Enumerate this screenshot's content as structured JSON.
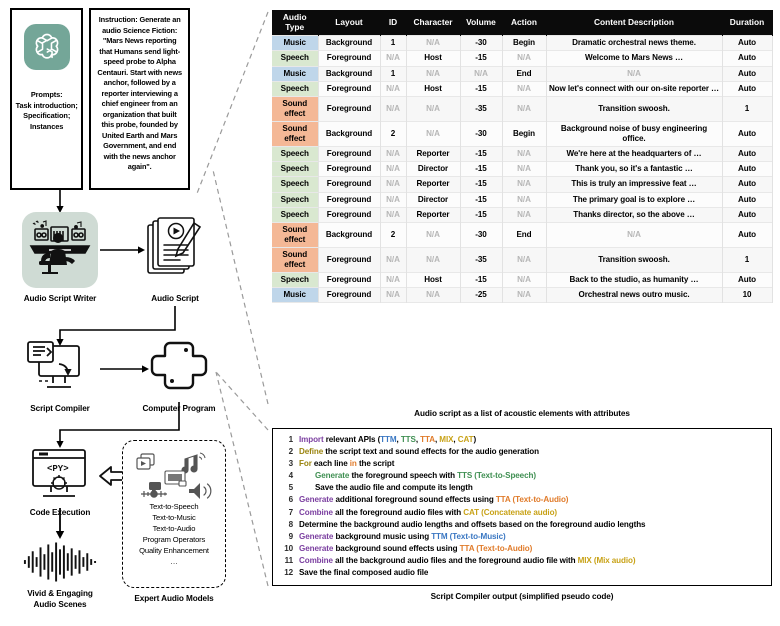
{
  "left_pipeline": {
    "prompts_label": "Prompts:\nTask introduction;\nSpecification;\nInstances",
    "prompts_label_lines": [
      "Prompts:",
      "Task introduction;",
      "Specification;",
      "Instances"
    ],
    "instruction_text": "Instruction: Generate an audio Science Fiction: \"Mars News reporting that Humans send light-speed probe to Alpha Centauri. Start with news anchor, followed by a reporter interviewing a chief engineer from an organization that built this probe, founded by United Earth and Mars Government, and end with the news anchor again\".",
    "nodes": {
      "audio_script_writer": "Audio Script Writer",
      "audio_script": "Audio Script",
      "script_compiler": "Script Compiler",
      "computer_program": "Computer Program",
      "code_execution": "Code Execution",
      "vivid_scenes_line1": "Vivid & Engaging",
      "vivid_scenes_line2": "Audio Scenes",
      "expert_audio_models": "Expert Audio Models"
    },
    "expert_models": [
      "Text-to-Speech",
      "Text-to-Music",
      "Text-to-Audio",
      "Program Operators",
      "Quality Enhancement",
      "…"
    ],
    "logo_bg_color": "#74a698",
    "writer_bg_color": "#cfdbd4"
  },
  "table": {
    "caption": "Audio script as a list of acoustic elements with attributes",
    "headers": [
      "Audio Type",
      "Layout",
      "ID",
      "Character",
      "Volume",
      "Action",
      "Content Description",
      "Duration"
    ],
    "header_lines": [
      [
        "Audio",
        "Type"
      ],
      [
        "Layout"
      ],
      [
        "ID"
      ],
      [
        "Character"
      ],
      [
        "Volume"
      ],
      [
        "Action"
      ],
      [
        "Content Description"
      ],
      [
        "Duration"
      ]
    ],
    "type_colors": {
      "Music": "#bfd6ea",
      "Speech": "#d9e8d0",
      "Sound effect": "#f4b896"
    },
    "rows": [
      {
        "type": "Music",
        "type_class": "music",
        "layout": "Background",
        "id": "1",
        "character": "N/A",
        "volume": "-30",
        "action": "Begin",
        "description": "Dramatic orchestral news theme.",
        "duration": "Auto"
      },
      {
        "type": "Speech",
        "type_class": "speech",
        "layout": "Foreground",
        "id": "N/A",
        "character": "Host",
        "volume": "-15",
        "action": "N/A",
        "description": "Welcome to Mars News …",
        "duration": "Auto"
      },
      {
        "type": "Music",
        "type_class": "music",
        "layout": "Background",
        "id": "1",
        "character": "N/A",
        "volume": "N/A",
        "action": "End",
        "description": "N/A",
        "duration": "Auto"
      },
      {
        "type": "Speech",
        "type_class": "speech",
        "layout": "Foreground",
        "id": "N/A",
        "character": "Host",
        "volume": "-15",
        "action": "N/A",
        "description": "Now let's connect with our on-site reporter …",
        "duration": "Auto"
      },
      {
        "type": "Sound effect",
        "type_class": "sfx",
        "layout": "Foreground",
        "id": "N/A",
        "character": "N/A",
        "volume": "-35",
        "action": "N/A",
        "description": "Transition swoosh.",
        "duration": "1"
      },
      {
        "type": "Sound effect",
        "type_class": "sfx",
        "layout": "Background",
        "id": "2",
        "character": "N/A",
        "volume": "-30",
        "action": "Begin",
        "description": "Background noise of busy engineering office.",
        "duration": "Auto"
      },
      {
        "type": "Speech",
        "type_class": "speech",
        "layout": "Foreground",
        "id": "N/A",
        "character": "Reporter",
        "volume": "-15",
        "action": "N/A",
        "description": "We're here at the headquarters of …",
        "duration": "Auto"
      },
      {
        "type": "Speech",
        "type_class": "speech",
        "layout": "Foreground",
        "id": "N/A",
        "character": "Director",
        "volume": "-15",
        "action": "N/A",
        "description": "Thank you, so it's a fantastic …",
        "duration": "Auto"
      },
      {
        "type": "Speech",
        "type_class": "speech",
        "layout": "Foreground",
        "id": "N/A",
        "character": "Reporter",
        "volume": "-15",
        "action": "N/A",
        "description": "This is truly an impressive feat …",
        "duration": "Auto"
      },
      {
        "type": "Speech",
        "type_class": "speech",
        "layout": "Foreground",
        "id": "N/A",
        "character": "Director",
        "volume": "-15",
        "action": "N/A",
        "description": "The primary goal is to explore …",
        "duration": "Auto"
      },
      {
        "type": "Speech",
        "type_class": "speech",
        "layout": "Foreground",
        "id": "N/A",
        "character": "Reporter",
        "volume": "-15",
        "action": "N/A",
        "description": "Thanks director, so the above …",
        "duration": "Auto"
      },
      {
        "type": "Sound effect",
        "type_class": "sfx",
        "layout": "Background",
        "id": "2",
        "character": "N/A",
        "volume": "-30",
        "action": "End",
        "description": "N/A",
        "duration": "Auto"
      },
      {
        "type": "Sound effect",
        "type_class": "sfx",
        "layout": "Foreground",
        "id": "N/A",
        "character": "N/A",
        "volume": "-35",
        "action": "N/A",
        "description": "Transition swoosh.",
        "duration": "1"
      },
      {
        "type": "Speech",
        "type_class": "speech",
        "layout": "Foreground",
        "id": "N/A",
        "character": "Host",
        "volume": "-15",
        "action": "N/A",
        "description": "Back to the studio, as humanity …",
        "duration": "Auto"
      },
      {
        "type": "Music",
        "type_class": "music",
        "layout": "Foreground",
        "id": "N/A",
        "character": "N/A",
        "volume": "-25",
        "action": "N/A",
        "description": "Orchestral news outro music.",
        "duration": "10"
      }
    ]
  },
  "pseudocode": {
    "caption": "Script Compiler output (simplified pseudo code)",
    "lines": [
      {
        "n": "1",
        "indent": 0,
        "parts": [
          {
            "t": "Import ",
            "c": "kw-purple"
          },
          {
            "t": "relevant APIs (",
            "c": "kw-black"
          },
          {
            "t": "TTM",
            "c": "kw-blue"
          },
          {
            "t": ", ",
            "c": "kw-black"
          },
          {
            "t": "TTS",
            "c": "kw-green"
          },
          {
            "t": ", ",
            "c": "kw-black"
          },
          {
            "t": "TTA",
            "c": "kw-orange"
          },
          {
            "t": ", ",
            "c": "kw-black"
          },
          {
            "t": "MIX",
            "c": "kw-gold"
          },
          {
            "t": ", ",
            "c": "kw-black"
          },
          {
            "t": "CAT",
            "c": "kw-gold"
          },
          {
            "t": ")",
            "c": "kw-black"
          }
        ]
      },
      {
        "n": "2",
        "indent": 0,
        "parts": [
          {
            "t": "Define ",
            "c": "kw-olive"
          },
          {
            "t": "the script text and sound effects for the audio generation",
            "c": "kw-black"
          }
        ]
      },
      {
        "n": "3",
        "indent": 0,
        "parts": [
          {
            "t": "For ",
            "c": "kw-olive"
          },
          {
            "t": "each line ",
            "c": "kw-black"
          },
          {
            "t": "in ",
            "c": "kw-orange"
          },
          {
            "t": "the script",
            "c": "kw-black"
          }
        ]
      },
      {
        "n": "4",
        "indent": 1,
        "parts": [
          {
            "t": "Generate ",
            "c": "kw-green"
          },
          {
            "t": "the foreground speech with ",
            "c": "kw-black"
          },
          {
            "t": "TTS (Text-to-Speech)",
            "c": "kw-green"
          }
        ]
      },
      {
        "n": "5",
        "indent": 1,
        "parts": [
          {
            "t": "Save the audio file and compute its length",
            "c": "kw-black"
          }
        ]
      },
      {
        "n": "6",
        "indent": 0,
        "parts": [
          {
            "t": "Generate ",
            "c": "kw-purple"
          },
          {
            "t": "additional foreground sound effects using ",
            "c": "kw-black"
          },
          {
            "t": "TTA (Text-to-Audio)",
            "c": "kw-orange"
          }
        ]
      },
      {
        "n": "7",
        "indent": 0,
        "parts": [
          {
            "t": "Combine ",
            "c": "kw-purple"
          },
          {
            "t": "all the foreground audio files with ",
            "c": "kw-black"
          },
          {
            "t": "CAT (Concatenate audio)",
            "c": "kw-gold"
          }
        ]
      },
      {
        "n": "8",
        "indent": 0,
        "parts": [
          {
            "t": "Determine the background audio lengths and offsets based on the foreground audio lengths",
            "c": "kw-black"
          }
        ]
      },
      {
        "n": "9",
        "indent": 0,
        "parts": [
          {
            "t": "Generate ",
            "c": "kw-purple"
          },
          {
            "t": "background music using ",
            "c": "kw-black"
          },
          {
            "t": "TTM (Text-to-Music)",
            "c": "kw-blue"
          }
        ]
      },
      {
        "n": "10",
        "indent": 0,
        "parts": [
          {
            "t": "Generate ",
            "c": "kw-purple"
          },
          {
            "t": "background sound effects using ",
            "c": "kw-black"
          },
          {
            "t": "TTA (Text-to-Audio)",
            "c": "kw-orange"
          }
        ]
      },
      {
        "n": "11",
        "indent": 0,
        "parts": [
          {
            "t": "Combine ",
            "c": "kw-purple"
          },
          {
            "t": "all the background audio files and the foreground audio file with ",
            "c": "kw-black"
          },
          {
            "t": "MIX (Mix audio)",
            "c": "kw-gold"
          }
        ]
      },
      {
        "n": "12",
        "indent": 0,
        "parts": [
          {
            "t": "Save the final composed audio file",
            "c": "kw-black"
          }
        ]
      }
    ]
  }
}
